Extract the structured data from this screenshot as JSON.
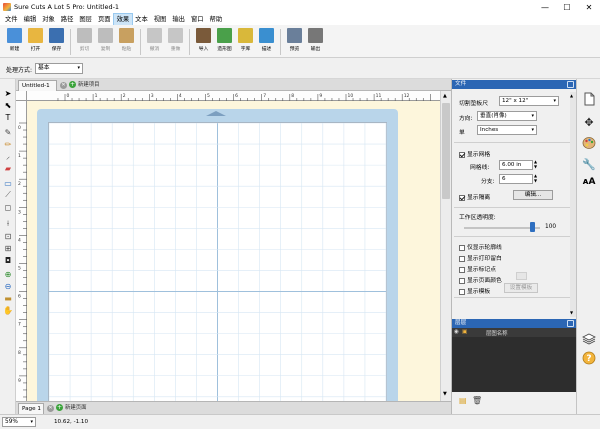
{
  "window": {
    "title": "Sure Cuts A Lot 5 Pro: Untitled-1",
    "minimize": "—",
    "maximize": "☐",
    "close": "✕"
  },
  "menu": [
    "文件",
    "编辑",
    "对象",
    "路径",
    "图层",
    "页面",
    "效果",
    "文本",
    "视图",
    "输出",
    "窗口",
    "帮助"
  ],
  "menu_active_index": 6,
  "toolbar": [
    {
      "label": "新建",
      "icon": "new-document-icon",
      "color": "#4a90d9",
      "enabled": true
    },
    {
      "label": "打开",
      "icon": "open-folder-icon",
      "color": "#e8b640",
      "enabled": true
    },
    {
      "label": "保存",
      "icon": "save-disk-icon",
      "color": "#3b6fb0",
      "enabled": true
    },
    {
      "label": "剪切",
      "icon": "cut-icon",
      "color": "#bdbdbd",
      "enabled": false
    },
    {
      "label": "复制",
      "icon": "copy-icon",
      "color": "#bdbdbd",
      "enabled": false
    },
    {
      "label": "粘贴",
      "icon": "paste-icon",
      "color": "#c8a060",
      "enabled": false
    },
    {
      "label": "撤消",
      "icon": "undo-icon",
      "color": "#c6c6c6",
      "enabled": false
    },
    {
      "label": "重做",
      "icon": "redo-icon",
      "color": "#c6c6c6",
      "enabled": false
    },
    {
      "label": "导入",
      "icon": "import-image-icon",
      "color": "#7a5a3a",
      "enabled": true
    },
    {
      "label": "造形图",
      "icon": "shape-library-icon",
      "color": "#4aa04a",
      "enabled": true
    },
    {
      "label": "字库",
      "icon": "font-library-icon",
      "color": "#d9b83a",
      "enabled": true
    },
    {
      "label": "描述",
      "icon": "trace-icon",
      "color": "#3a8fd0",
      "enabled": true
    },
    {
      "label": "预览",
      "icon": "preview-icon",
      "color": "#6a7f9a",
      "enabled": true
    },
    {
      "label": "输出",
      "icon": "cut-output-icon",
      "color": "#777777",
      "enabled": true
    }
  ],
  "property_bar": {
    "label": "处理方式:",
    "value": "基本"
  },
  "doc_tabs": {
    "active": "Untitled-1",
    "new_tab": "新建项目"
  },
  "page_tabs": {
    "active": "Page 1",
    "new_tab": "新建页面"
  },
  "ruler_labels": [
    "0",
    "1",
    "2",
    "3",
    "4",
    "5",
    "6",
    "7",
    "8",
    "9",
    "10",
    "11",
    "12"
  ],
  "status": {
    "zoom": "59%",
    "coords": "10.62, -1.10"
  },
  "panel_document": {
    "header": "文件",
    "mat_label": "切割垫板尺",
    "mat_value": "12\" x 12\"",
    "orientation_label": "方向:",
    "orientation_value": "垂直(肖像)",
    "units_label": "单",
    "units_value": "Inches",
    "show_grid_label": "显示网格",
    "show_grid": true,
    "grid_spacing_label": "网格线:",
    "grid_spacing_value": "6.00 in",
    "divisions_label": "分支:",
    "divisions_value": "6",
    "show_margin_label": "显示隔离",
    "show_margin": true,
    "edit_button": "编辑...",
    "workarea_opacity_label": "工作区透明度:",
    "workarea_opacity_value": "100",
    "options": [
      {
        "label": "仅显示轮廓线",
        "checked": false
      },
      {
        "label": "显示打印留白",
        "checked": false
      },
      {
        "label": "显示标记点",
        "checked": false
      },
      {
        "label": "显示页面颜色",
        "checked": false
      },
      {
        "label": "显示模板",
        "checked": false
      }
    ],
    "template_button": "设置模板"
  },
  "panel_layers": {
    "header": "层层",
    "column": "层图名称"
  },
  "colors": {
    "titlebar_accent": "#2b66b4",
    "mat": "#b9d5ea",
    "canvas_bg": "#fdf6dc",
    "grid_minor": "#d6e6f3",
    "grid_major": "#9fc0dc"
  }
}
